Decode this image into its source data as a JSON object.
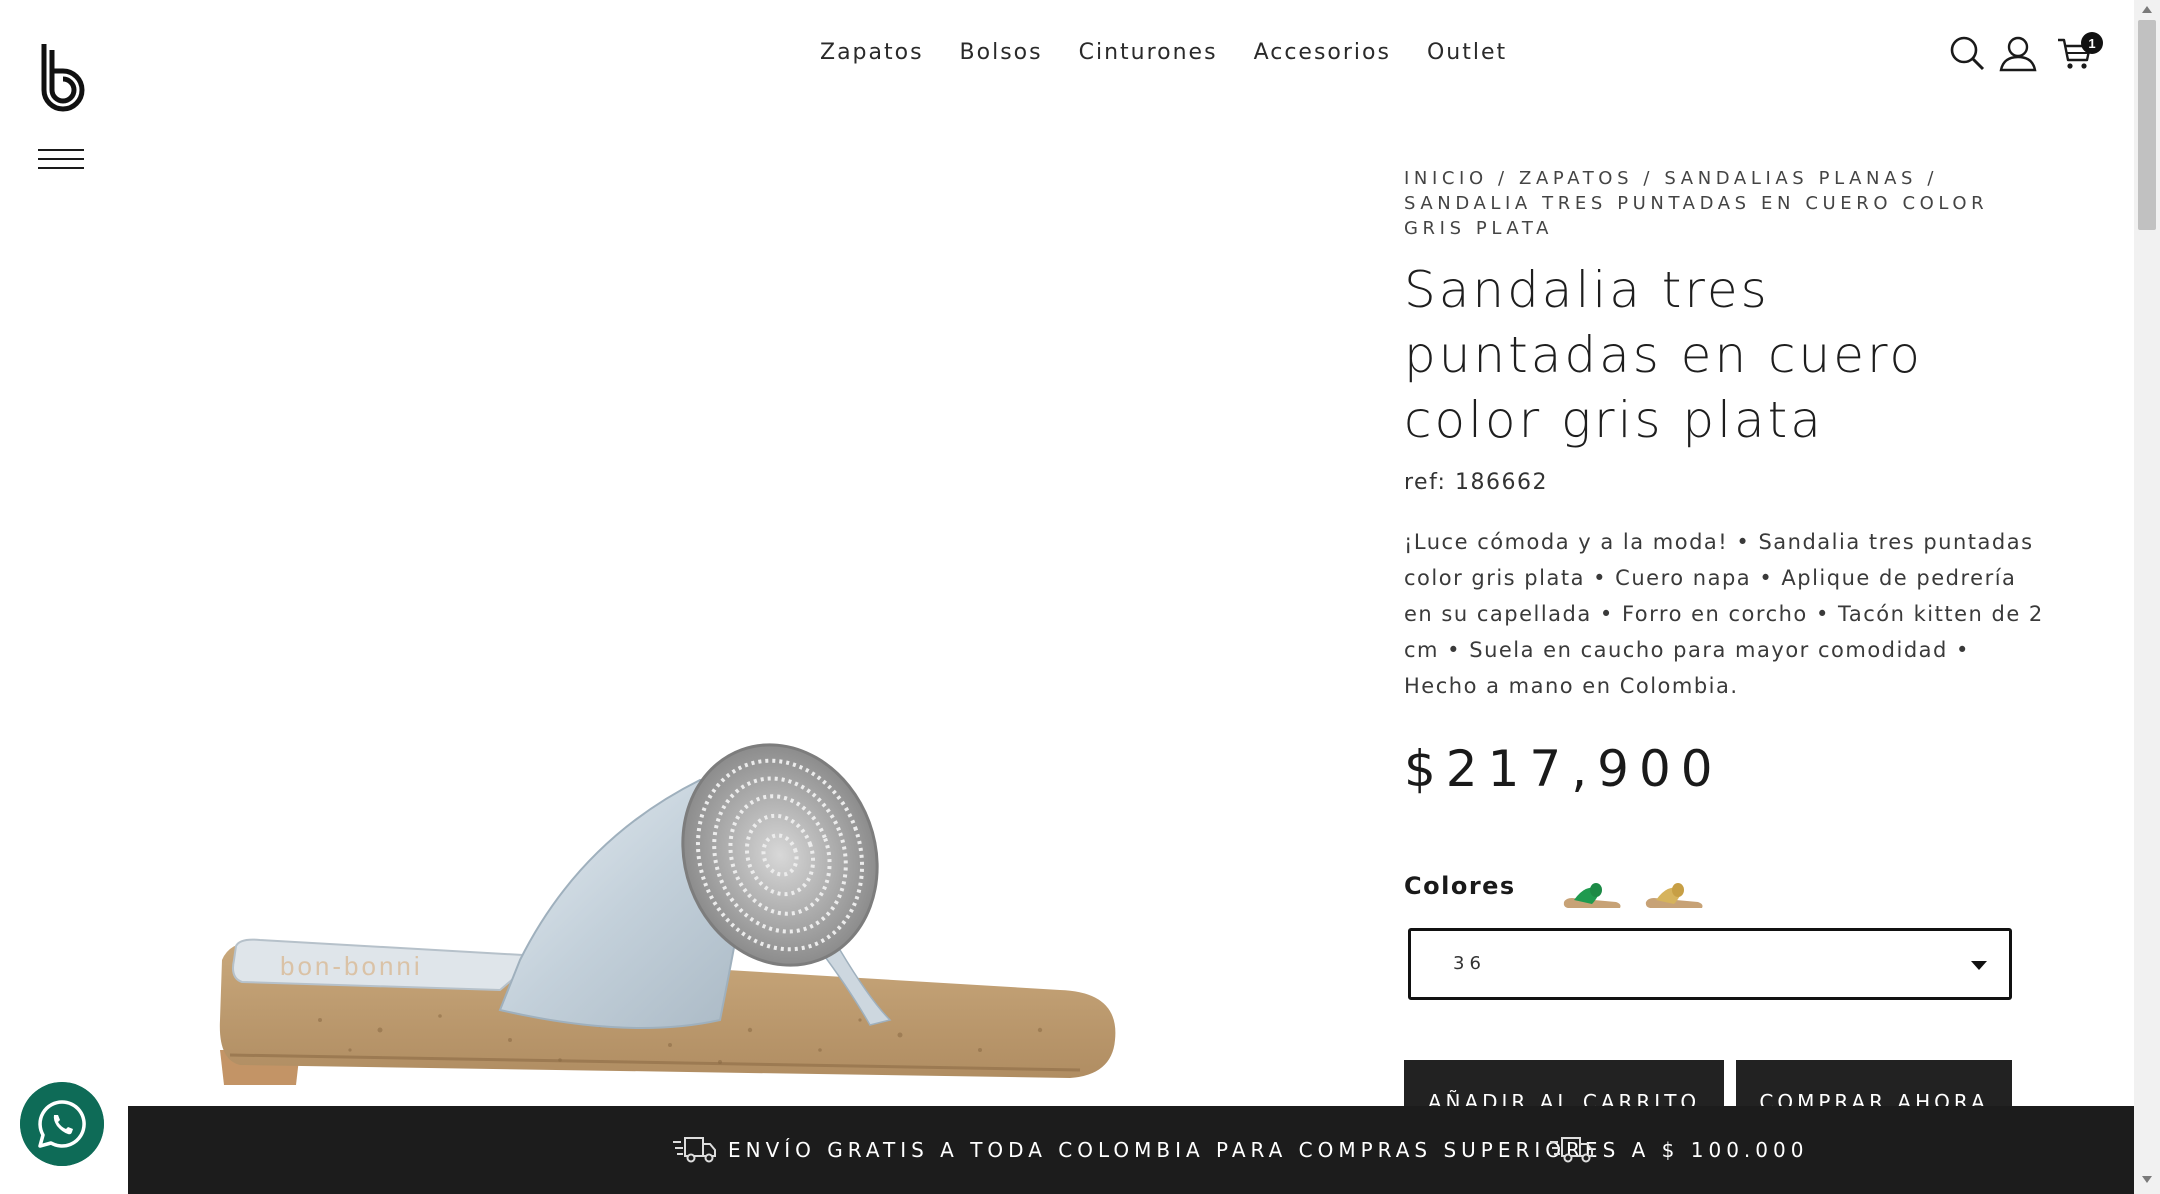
{
  "nav": {
    "items": [
      "Zapatos",
      "Bolsos",
      "Cinturones",
      "Accesorios",
      "Outlet"
    ]
  },
  "header": {
    "icons": [
      "search-icon",
      "user-icon",
      "cart-icon"
    ],
    "cart_count": "1"
  },
  "breadcrumb": {
    "items": [
      "INICIO",
      "ZAPATOS",
      "SANDALIAS PLANAS",
      "SANDALIA TRES PUNTADAS EN CUERO COLOR GRIS PLATA"
    ],
    "separator": " / "
  },
  "product": {
    "title": "Sandalia tres puntadas en cuero color gris plata",
    "ref": "ref: 186662",
    "description": "¡Luce cómoda y a la moda! • Sandalia tres puntadas color gris plata • Cuero napa • Aplique de pedrería en su capellada • Forro en corcho • Tacón kitten de 2 cm • Suela en caucho para mayor comodidad • Hecho a mano en Colombia.",
    "price": "$217,900",
    "colors_label": "Colores",
    "color_swatches": [
      "green-sandal-swatch",
      "gold-sandal-swatch"
    ],
    "size_selected": "36",
    "add_to_cart": "AÑADIR AL CARRITO",
    "buy_now": "COMPRAR AHORA"
  },
  "banner": {
    "text": "ENVÍO GRATIS A TODA COLOMBIA PARA COMPRAS SUPERIORES A $ 100.000"
  },
  "colors": {
    "banner_bg": "#1c1c1c",
    "button_bg": "#222222",
    "whatsapp_bg": "#0e6b57"
  }
}
